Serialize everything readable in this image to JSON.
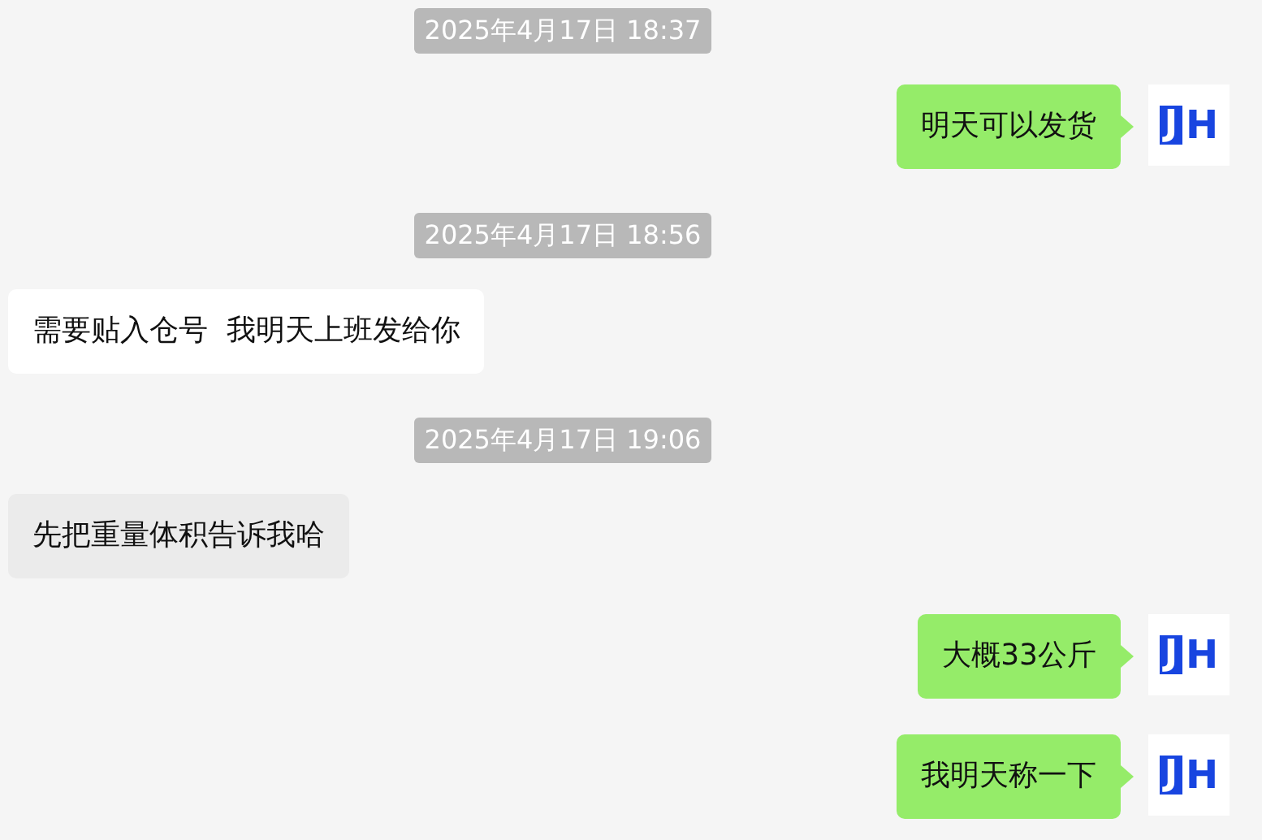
{
  "messages": [
    {
      "kind": "time",
      "text": "2025年4月17日 18:37"
    },
    {
      "kind": "sent",
      "text": "明天可以发货",
      "avatar": {
        "mark": "J",
        "text": "H"
      }
    },
    {
      "kind": "time",
      "text": "2025年4月17日 18:56"
    },
    {
      "kind": "received",
      "text": "需要贴入仓号  我明天上班发给你",
      "highlighted": false
    },
    {
      "kind": "time",
      "text": "2025年4月17日 19:06"
    },
    {
      "kind": "received",
      "text": "先把重量体积告诉我哈",
      "highlighted": true
    },
    {
      "kind": "sent",
      "text": "大概33公斤",
      "avatar": {
        "mark": "J",
        "text": "H"
      }
    },
    {
      "kind": "sent",
      "text": "我明天称一下",
      "avatar": {
        "mark": "J",
        "text": "H"
      }
    }
  ]
}
